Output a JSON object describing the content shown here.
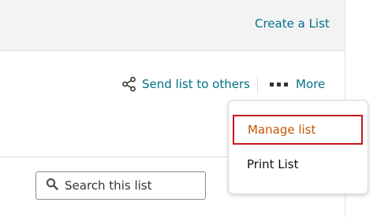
{
  "header": {
    "create_list_label": "Create a List"
  },
  "actions": {
    "send_list_label": "Send list to others",
    "more_label": "More"
  },
  "search": {
    "placeholder": "Search this list"
  },
  "more_menu": {
    "items": [
      {
        "label": "Manage list",
        "highlighted": true
      },
      {
        "label": "Print List",
        "highlighted": false
      }
    ]
  },
  "colors": {
    "link": "#007185",
    "highlight_border": "#c7151c",
    "highlight_text": "#c45500",
    "header_bg": "#f3f3f3"
  },
  "icons": {
    "share": "share-icon",
    "more": "more-dots-icon",
    "search": "search-icon"
  }
}
